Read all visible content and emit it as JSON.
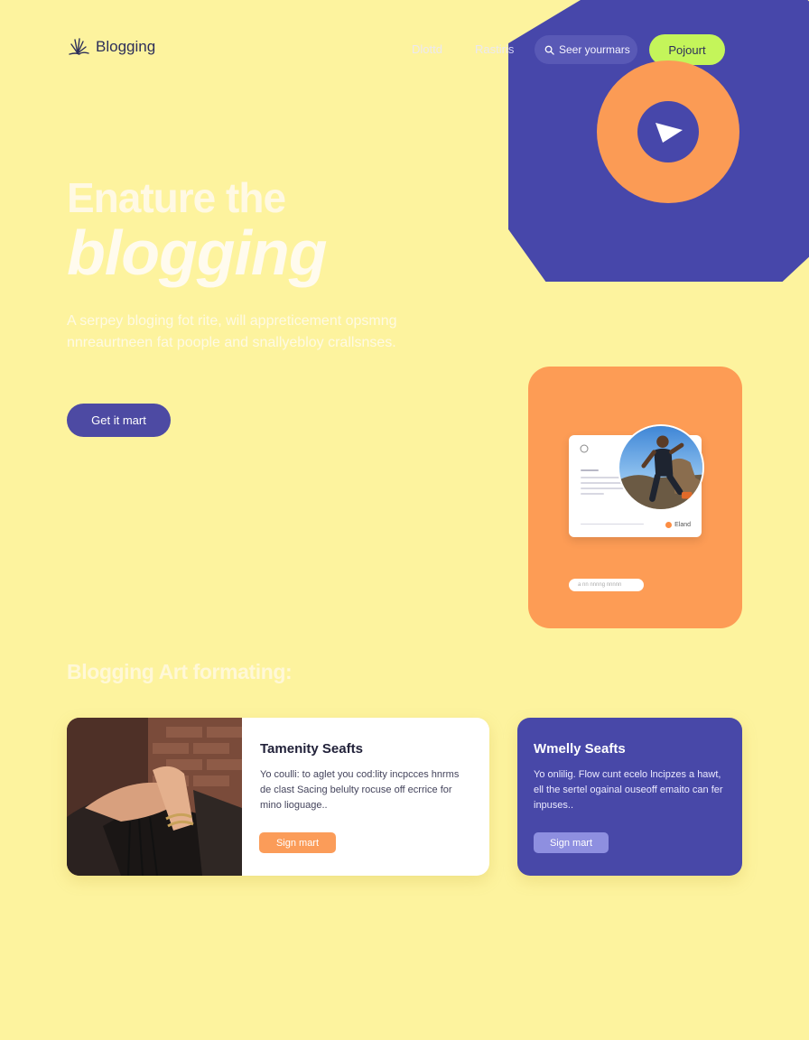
{
  "nav": {
    "logo_text": "Blogging",
    "links": [
      "Dlottd",
      "Rastiris"
    ],
    "search_label": "Seer yourmars",
    "cta_label": "Pojourt"
  },
  "hero": {
    "title_line1": "Enature the",
    "title_line2": "blogging",
    "description": "A serpey bloging fot rite, will appreticement opsmng nnreaurtneen fat poople and snallyebloy crallsnses.",
    "button_label": "Get it mart"
  },
  "preview": {
    "mini_badge": "Eland",
    "bar_text": "a nn nnnng nnnnn"
  },
  "section": {
    "title": "Blogging Art formating:"
  },
  "cards": [
    {
      "title": "Tamenity Seafts",
      "text": "Yo coulli: to aglet you cod:lity incpcces hnrms de clast Sacing belulty rocuse off ecrrice for mino lioguage..",
      "button": "Sign mart"
    },
    {
      "title": "Wmelly Seafts",
      "text": "Yo onlilig. Flow cunt ecelo lncipzes a hawt, ell the sertel ogainal ouseoff emaito can fer inpuses..",
      "button": "Sign mart"
    }
  ],
  "colors": {
    "background": "#fdf39e",
    "indigo": "#4747aa",
    "orange": "#fd9c55",
    "lime": "#c4f55a"
  }
}
